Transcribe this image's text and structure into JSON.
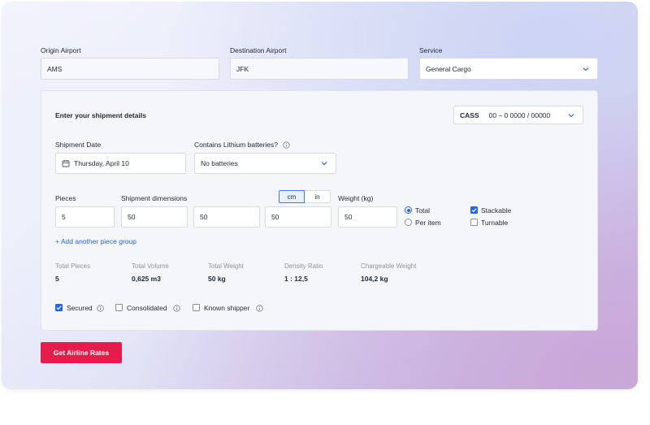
{
  "route": {
    "origin_label": "Origin Airport",
    "origin_value": "AMS",
    "destination_label": "Destination Airport",
    "destination_value": "JFK",
    "service_label": "Service",
    "service_value": "General Cargo"
  },
  "details": {
    "heading": "Enter your shipment details",
    "cass_label": "CASS",
    "cass_value": "00 – 0 0000 / 00000",
    "shipment_date_label": "Shipment Date",
    "shipment_date_value": "Thursday, April 10",
    "lithium_label": "Contains Lithium batteries?",
    "lithium_value": "No batteries"
  },
  "pieces": {
    "pieces_label": "Pieces",
    "pieces_value": "5",
    "dimensions_label": "Shipment dimensions",
    "unit_cm": "cm",
    "unit_in": "in",
    "unit_selected": "cm",
    "length_value": "50",
    "width_value": "50",
    "height_value": "50",
    "weight_label": "Weight (kg)",
    "weight_value": "50",
    "weight_mode_total": "Total",
    "weight_mode_per_item": "Per item",
    "weight_mode_selected": "Total",
    "stackable_label": "Stackable",
    "stackable_checked": true,
    "turnable_label": "Turnable",
    "turnable_checked": false,
    "add_group_link": "+ Add another piece group"
  },
  "totals": {
    "total_pieces_label": "Total Pieces",
    "total_pieces_value": "5",
    "total_volume_label": "Total Volume",
    "total_volume_value": "0,625 m3",
    "total_weight_label": "Total Weight",
    "total_weight_value": "50 kg",
    "density_label": "Density Ratio",
    "density_value": "1 : 12,5",
    "chargeable_label": "Chargeable Weight",
    "chargeable_value": "104,2 kg"
  },
  "options": {
    "secured_label": "Secured",
    "secured_checked": true,
    "consolidated_label": "Consolidated",
    "consolidated_checked": false,
    "known_shipper_label": "Known shipper",
    "known_shipper_checked": false
  },
  "actions": {
    "submit_label": "Get Airline Rates"
  },
  "colors": {
    "accent": "#2563eb",
    "primary_button": "#e31e4c"
  },
  "icons": [
    "chevron-down-icon",
    "calendar-icon",
    "info-icon",
    "check-icon"
  ]
}
